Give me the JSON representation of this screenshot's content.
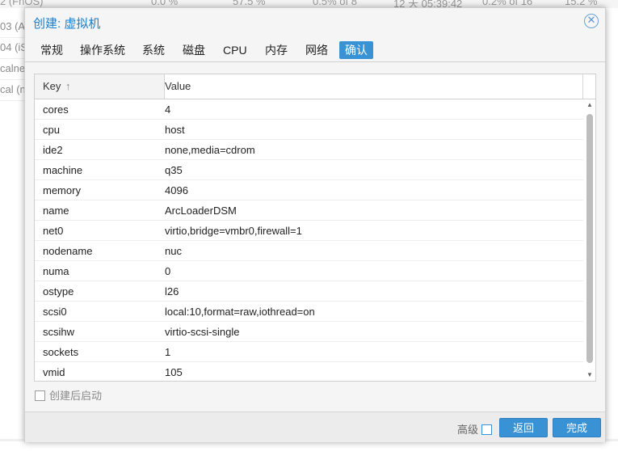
{
  "background": {
    "top_row": [
      "2 (FnOS)",
      "0.0 %",
      "57.5 %",
      "0.5% of 8",
      "12 天 05:39:42",
      "0.2% of 16",
      "15.2 %"
    ],
    "left_items": [
      "03 (Al",
      "04 (iS",
      "calne",
      "cal (n"
    ]
  },
  "dialog": {
    "title": "创建: 虚拟机",
    "tabs": [
      {
        "label": "常规"
      },
      {
        "label": "操作系统"
      },
      {
        "label": "系统"
      },
      {
        "label": "磁盘"
      },
      {
        "label": "CPU"
      },
      {
        "label": "内存"
      },
      {
        "label": "网络"
      },
      {
        "label": "确认"
      }
    ],
    "active_tab": "确认",
    "grid": {
      "col_key": "Key",
      "col_value": "Value",
      "sort_icon": "↑",
      "rows": [
        {
          "key": "cores",
          "value": "4"
        },
        {
          "key": "cpu",
          "value": "host"
        },
        {
          "key": "ide2",
          "value": "none,media=cdrom"
        },
        {
          "key": "machine",
          "value": "q35"
        },
        {
          "key": "memory",
          "value": "4096"
        },
        {
          "key": "name",
          "value": "ArcLoaderDSM"
        },
        {
          "key": "net0",
          "value": "virtio,bridge=vmbr0,firewall=1"
        },
        {
          "key": "nodename",
          "value": "nuc"
        },
        {
          "key": "numa",
          "value": "0"
        },
        {
          "key": "ostype",
          "value": "l26"
        },
        {
          "key": "scsi0",
          "value": "local:10,format=raw,iothread=on"
        },
        {
          "key": "scsihw",
          "value": "virtio-scsi-single"
        },
        {
          "key": "sockets",
          "value": "1"
        },
        {
          "key": "vmid",
          "value": "105"
        }
      ]
    },
    "start_after_create": "创建后启动",
    "advanced": "高级",
    "back_label": "返回",
    "finish_label": "完成",
    "colors": {
      "accent": "#3892d4",
      "title": "#157fcc"
    }
  }
}
